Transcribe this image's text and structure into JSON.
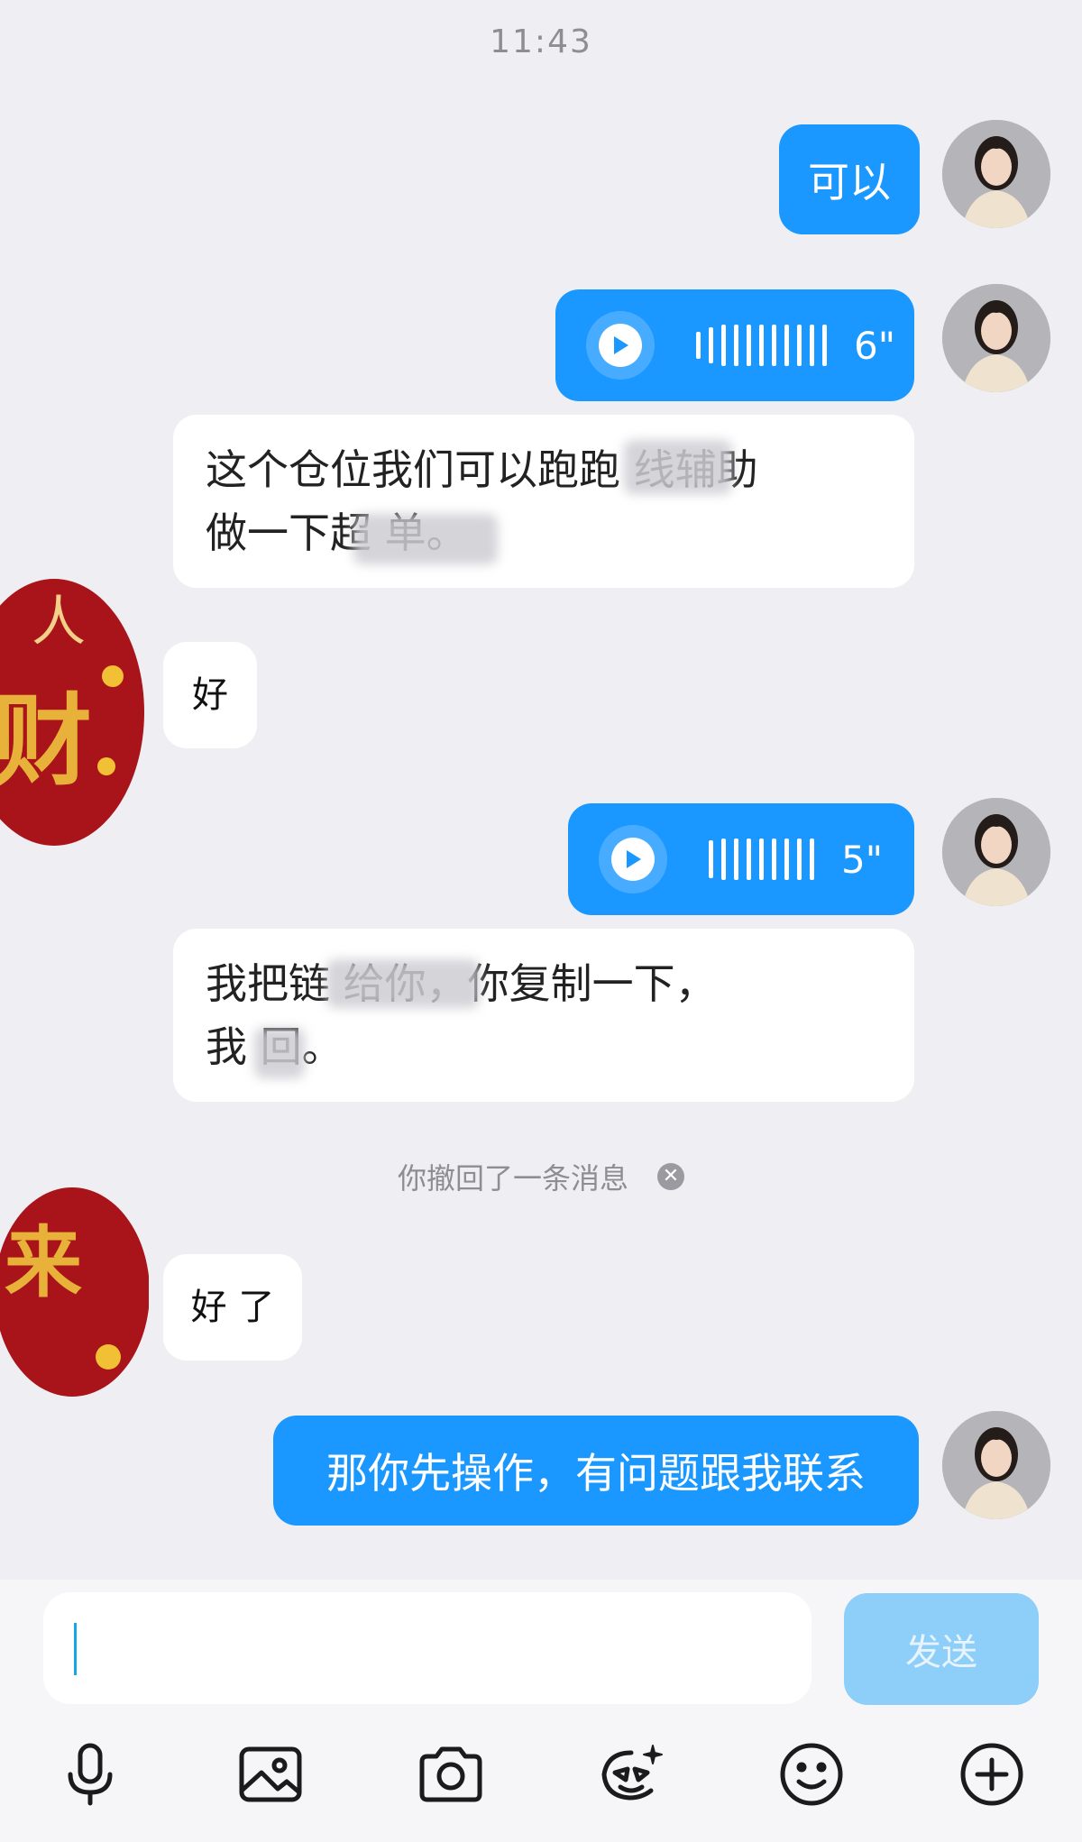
{
  "timestamp": "11:43",
  "messages": [
    {
      "side": "out",
      "type": "text",
      "text": "可以"
    },
    {
      "side": "out",
      "type": "voice",
      "duration": "6\""
    },
    {
      "side": "out",
      "type": "text",
      "line1": "这个仓位我们可以跑跑  线辅助",
      "line2": "做一下超  单。"
    },
    {
      "side": "in",
      "type": "text",
      "text": "好"
    },
    {
      "side": "out",
      "type": "voice",
      "duration": "5\""
    },
    {
      "side": "out",
      "type": "text",
      "line1": "我把链    给你，你复制一下，",
      "line2": "我  回。"
    },
    {
      "side": "in",
      "type": "text",
      "text": "好 了"
    },
    {
      "side": "out",
      "type": "text",
      "text": "那你先操作，有问题跟我联系"
    }
  ],
  "recall_notice": "你撤回了一条消息",
  "sticker_chars": {
    "s1a": "财",
    "s1b": "人",
    "s2a": "来"
  },
  "composer": {
    "placeholder": "",
    "send_label": "发送"
  },
  "toolbar": [
    "mic-icon",
    "image-icon",
    "camera-icon",
    "sticker-icon",
    "emoji-icon",
    "plus-icon"
  ],
  "colors": {
    "accent": "#1a98ff",
    "send_disabled": "#8ecff9",
    "background": "#efeff3"
  }
}
